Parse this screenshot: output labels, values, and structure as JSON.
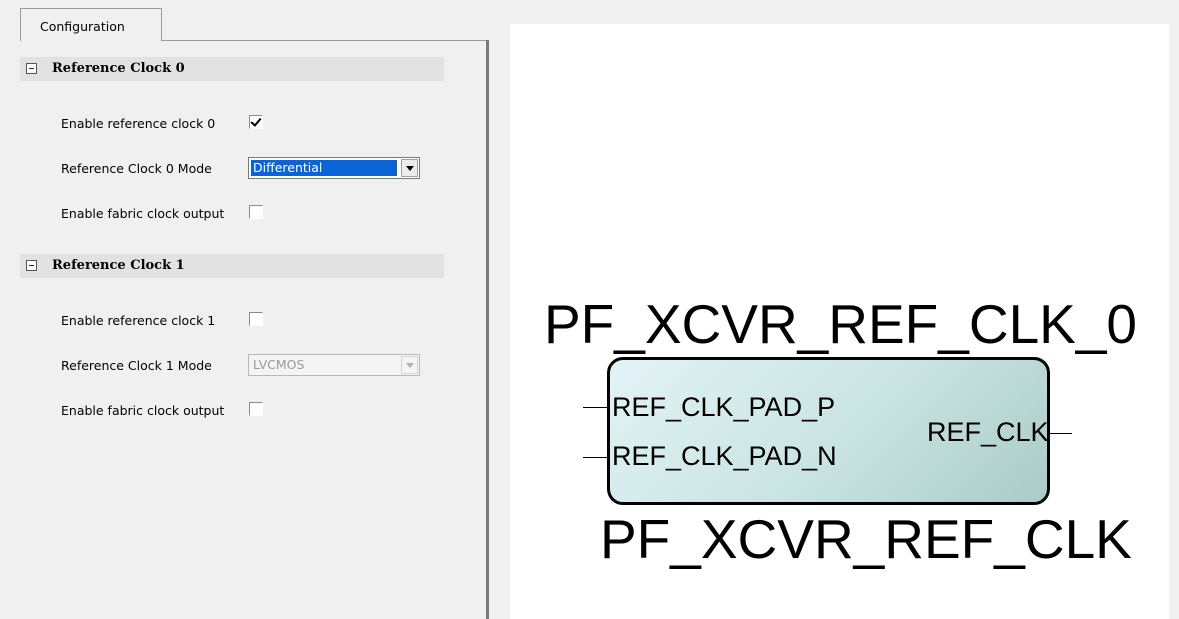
{
  "tabs": [
    {
      "label": "Configuration",
      "active": true
    }
  ],
  "sections": [
    {
      "title": "Reference Clock 0",
      "enable_label": "Enable reference clock 0",
      "enable_checked": true,
      "mode_label": "Reference Clock 0 Mode",
      "mode_value": "Differential",
      "mode_enabled": true,
      "fabric_label": "Enable fabric clock output",
      "fabric_checked": false
    },
    {
      "title": "Reference Clock 1",
      "enable_label": "Enable reference clock 1",
      "enable_checked": false,
      "mode_label": "Reference Clock 1 Mode",
      "mode_value": "LVCMOS",
      "mode_enabled": false,
      "fabric_label": "Enable fabric clock output",
      "fabric_checked": false
    }
  ],
  "diagram": {
    "instance_name": "PF_XCVR_REF_CLK_0",
    "component_name": "PF_XCVR_REF_CLK",
    "inputs": [
      "REF_CLK_PAD_P",
      "REF_CLK_PAD_N"
    ],
    "outputs": [
      "REF_CLK"
    ]
  },
  "colors": {
    "selection_blue": "#0a64d8",
    "block_fill_light": "#e2f3f6",
    "block_fill_dark": "#a9cbc8",
    "panel_bg": "#f0f0f0"
  }
}
